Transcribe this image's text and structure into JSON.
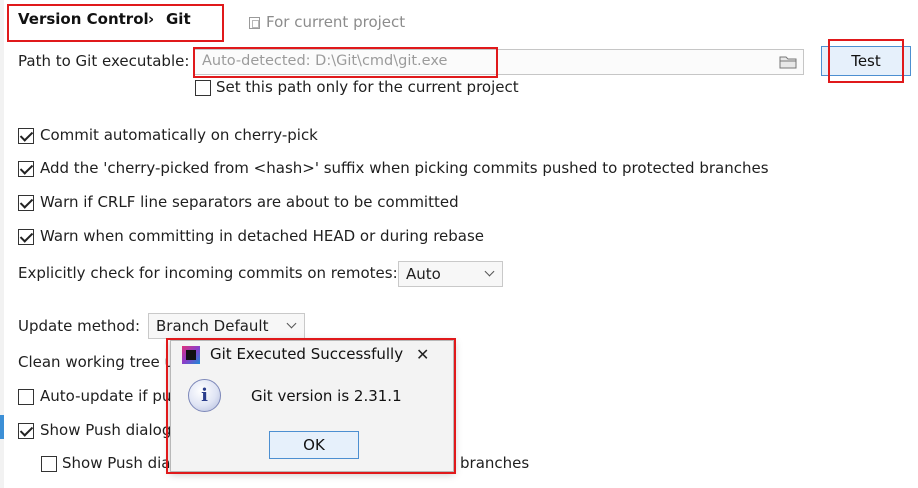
{
  "breadcrumb": {
    "parent": "Version Control",
    "separator": "›",
    "current": "Git",
    "scope_label": "For current project"
  },
  "git_path": {
    "label": "Path to Git executable:",
    "placeholder": "Auto-detected: D:\\Git\\cmd\\git.exe",
    "browse_icon": "folder-icon",
    "test_label": "Test",
    "project_only_label": "Set this path only for the current project",
    "project_only_checked": false
  },
  "options": [
    {
      "label": "Commit automatically on cherry-pick",
      "checked": true
    },
    {
      "label": "Add the 'cherry-picked from <hash>' suffix when picking commits pushed to protected branches",
      "checked": true
    },
    {
      "label": "Warn if CRLF line separators are about to be committed",
      "checked": true
    },
    {
      "label": "Warn when committing in detached HEAD or during rebase",
      "checked": true
    }
  ],
  "incoming": {
    "label": "Explicitly check for incoming commits on remotes:",
    "value": "Auto"
  },
  "update": {
    "label": "Update method:",
    "value": "Branch Default",
    "clean_label": "Clean working tree us",
    "auto_update_label": "Auto-update if pu",
    "auto_update_checked": false,
    "show_push_label": "Show Push dialog",
    "show_push_checked": true,
    "show_push_sub_prefix": "Show Push dia",
    "show_push_sub_suffix": "branches",
    "show_push_sub_checked": false
  },
  "dialog": {
    "title": "Git Executed Successfully",
    "close_glyph": "✕",
    "icon": "info-icon",
    "message": "Git version is 2.31.1",
    "ok_label": "OK"
  },
  "colors": {
    "annotation_red": "#e0191b",
    "button_border_blue": "#4c8fd1",
    "button_fill": "#e6f0fb"
  }
}
